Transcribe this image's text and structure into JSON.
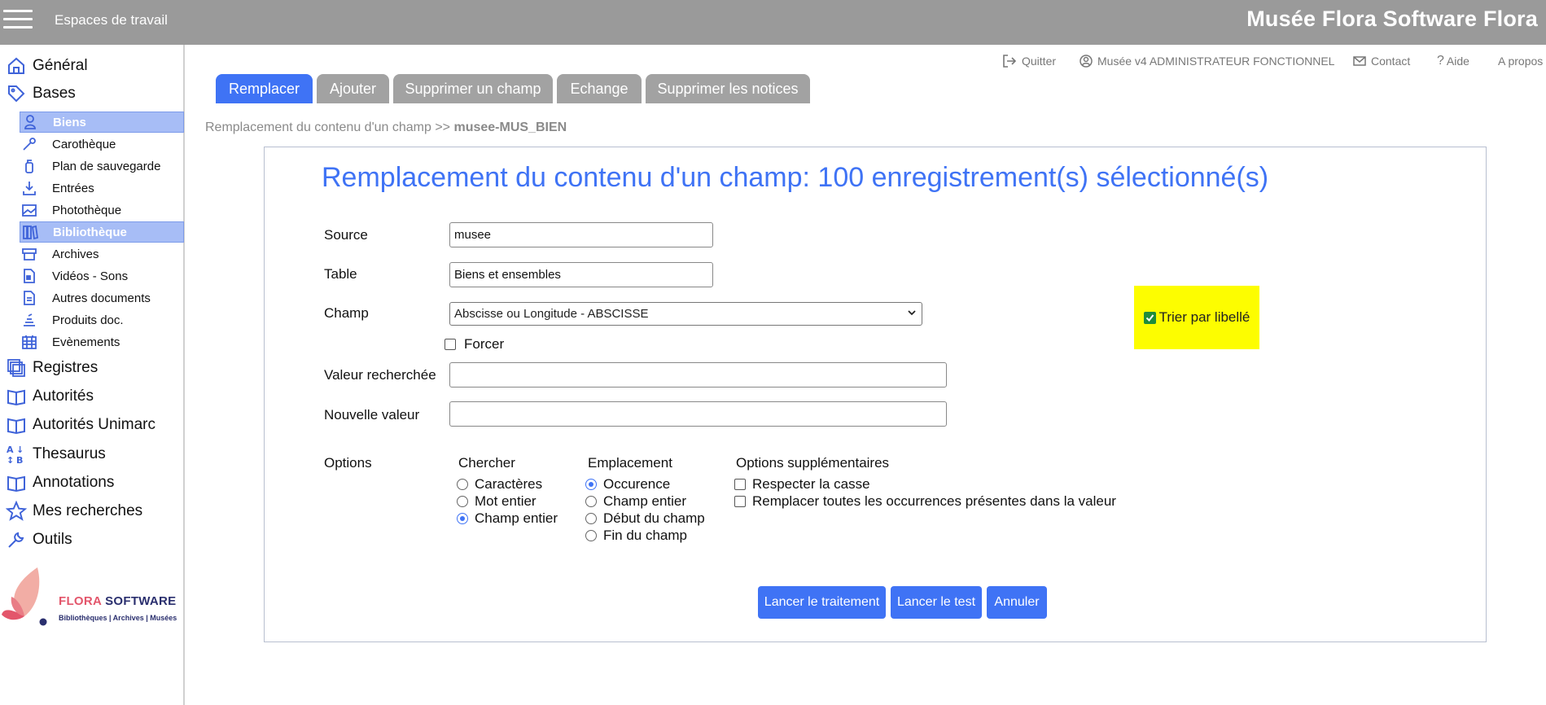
{
  "header": {
    "workspaces_label": "Espaces de travail",
    "app_title": "Musée Flora Software Flora"
  },
  "sidebar": {
    "general": "Général",
    "bases": "Bases",
    "sub_items": [
      "Biens",
      "Carothèque",
      "Plan de sauvegarde",
      "Entrées",
      "Photothèque",
      "Bibliothèque",
      "Archives",
      "Vidéos - Sons",
      "Autres documents",
      "Produits doc.",
      "Evènements"
    ],
    "registres": "Registres",
    "autorites": "Autorités",
    "autorites_unimarc": "Autorités Unimarc",
    "thesaurus": "Thesaurus",
    "annotations": "Annotations",
    "mes_recherches": "Mes recherches",
    "outils": "Outils",
    "logo_word1": "FLORA",
    "logo_word2": "SOFTWARE",
    "logo_tagline": "Bibliothèques | Archives | Musées"
  },
  "toplinks": {
    "quit": "Quitter",
    "user": "Musée v4 ADMINISTRATEUR FONCTIONNEL",
    "contact": "Contact",
    "help": "Aide",
    "about": "A propos"
  },
  "tabs": [
    "Remplacer",
    "Ajouter",
    "Supprimer un champ",
    "Echange",
    "Supprimer les notices"
  ],
  "breadcrumb": {
    "prefix": "Remplacement du contenu d'un champ >> ",
    "current": "musee-MUS_BIEN"
  },
  "form": {
    "title": "Remplacement du contenu d'un champ: 100 enregistrement(s) sélectionné(s)",
    "source_label": "Source",
    "source_value": "musee",
    "table_label": "Table",
    "table_value": "Biens et ensembles",
    "champ_label": "Champ",
    "champ_value": "Abscisse ou Longitude - ABSCISSE",
    "forcer_label": "Forcer",
    "trier_label": "Trier par libellé",
    "valeur_label": "Valeur recherchée",
    "valeur_value": "",
    "nouvelle_label": "Nouvelle valeur",
    "nouvelle_value": "",
    "options_label": "Options",
    "chercher_head": "Chercher",
    "chercher_options": [
      "Caractères",
      "Mot entier",
      "Champ entier"
    ],
    "emplacement_head": "Emplacement",
    "emplacement_options": [
      "Occurence",
      "Champ entier",
      "Début du champ",
      "Fin du champ"
    ],
    "supp_head": "Options supplémentaires",
    "supp_options": [
      "Respecter la casse",
      "Remplacer toutes les occurrences présentes dans la valeur"
    ]
  },
  "buttons": {
    "run": "Lancer le traitement",
    "test": "Lancer le test",
    "cancel": "Annuler"
  },
  "colors": {
    "accent": "#3f73f5",
    "topbar": "#9a9a9a",
    "highlight": "#fdfd00"
  }
}
